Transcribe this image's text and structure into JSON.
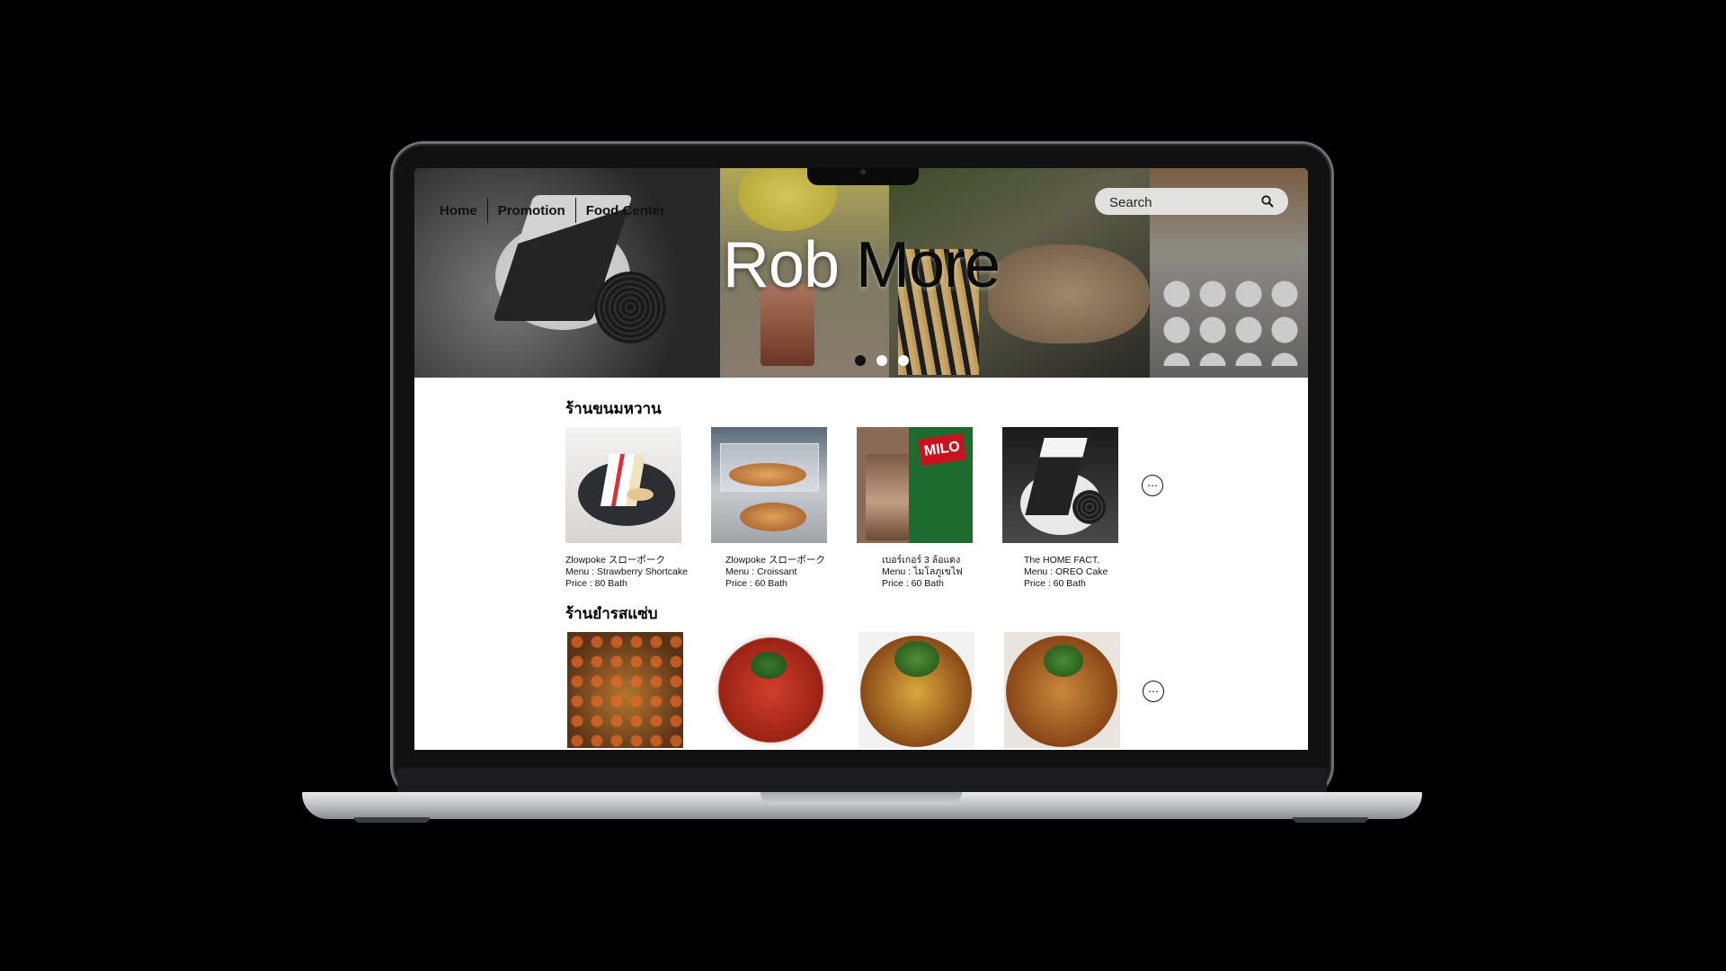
{
  "nav": {
    "items": [
      "Home",
      "Promotion",
      "Food Center"
    ]
  },
  "search": {
    "placeholder": "Search"
  },
  "hero": {
    "title_part1": "Rob",
    "title_part2": "More",
    "slides": 3,
    "active_slide": 1
  },
  "sections": [
    {
      "title": "ร้านขนมหวาน",
      "items": [
        {
          "name": "Zlowpoke スローポーク",
          "menu": "Menu : Strawberry Shortcake",
          "price": "Price : 80 Bath"
        },
        {
          "name": "Zlowpoke スローポーク",
          "menu": "Menu : Croissant",
          "price": "Price : 60 Bath"
        },
        {
          "name": "เบอร์เกอร์ 3 ล้อแดง",
          "menu": "Menu : ไมโลภูเขไฟ",
          "price": "Price : 60 Bath"
        },
        {
          "name": "The HOME FACT.",
          "menu": "Menu : OREO Cake",
          "price": "Price : 60 Bath"
        }
      ]
    },
    {
      "title": "ร้านยำรสแซ่บ",
      "items": []
    }
  ],
  "thumb_labels": {
    "milo": "MILO"
  },
  "more_icon": "⋯",
  "colors": {
    "dot_active": "#111111",
    "dot_inactive": "#ffffff",
    "text": "#111111"
  }
}
